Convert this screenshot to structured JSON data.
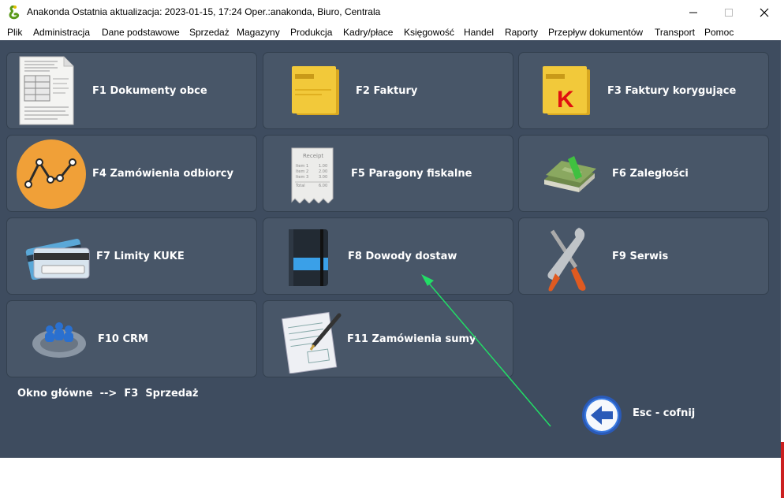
{
  "window": {
    "title": "Anakonda Ostatnia aktualizacja: 2023-01-15, 17:24 Oper.:anakonda, Biuro, Centrala",
    "icon": "snake-app-icon"
  },
  "menu": [
    {
      "label": "Plik"
    },
    {
      "label": "Administracja"
    },
    {
      "label": "Dane podstawowe"
    },
    {
      "label": "Sprzedaż"
    },
    {
      "label": "Magazyny"
    },
    {
      "label": "Produkcja"
    },
    {
      "label": "Kadry/płace"
    },
    {
      "label": "Księgowość"
    },
    {
      "label": "Handel"
    },
    {
      "label": "Raporty"
    },
    {
      "label": "Przepływ dokumentów"
    },
    {
      "label": "Transport"
    },
    {
      "label": "Pomoc"
    }
  ],
  "tiles": [
    {
      "label": "F1  Dokumenty obce",
      "icon": "document-icon"
    },
    {
      "label": "F2  Faktury",
      "icon": "invoice-folder-icon"
    },
    {
      "label": "F3  Faktury korygujące",
      "icon": "correction-invoice-icon"
    },
    {
      "label": "F4  Zamówienia odbiorcy",
      "icon": "chart-line-icon"
    },
    {
      "label": "F5  Paragony fiskalne",
      "icon": "receipt-icon"
    },
    {
      "label": "F6  Zaległości",
      "icon": "money-stack-icon"
    },
    {
      "label": "F7  Limity KUKE",
      "icon": "credit-card-icon"
    },
    {
      "label": "F8  Dowody dostaw",
      "icon": "notebook-icon"
    },
    {
      "label": "F9  Serwis",
      "icon": "wrench-screwdriver-icon"
    },
    {
      "label": "F10  CRM",
      "icon": "crm-gear-icon"
    },
    {
      "label": "F11  Zamówienia sumy",
      "icon": "signing-document-icon"
    }
  ],
  "status": "Okno główne  -->  F3  Sprzedaż",
  "escape": {
    "label": "Esc - cofnij",
    "icon": "back-arrow-icon"
  },
  "receipt_text": {
    "title": "Receipt",
    "lines": [
      "Item 1",
      "Item 2",
      "Item 3",
      "Total"
    ],
    "amounts": [
      "1.00",
      "2.00",
      "3.00",
      "6.00"
    ]
  },
  "correction_mark": "K",
  "colors": {
    "background": "#3e4c5f",
    "tile": "#485668",
    "accent_arrow": "#22dd66"
  }
}
